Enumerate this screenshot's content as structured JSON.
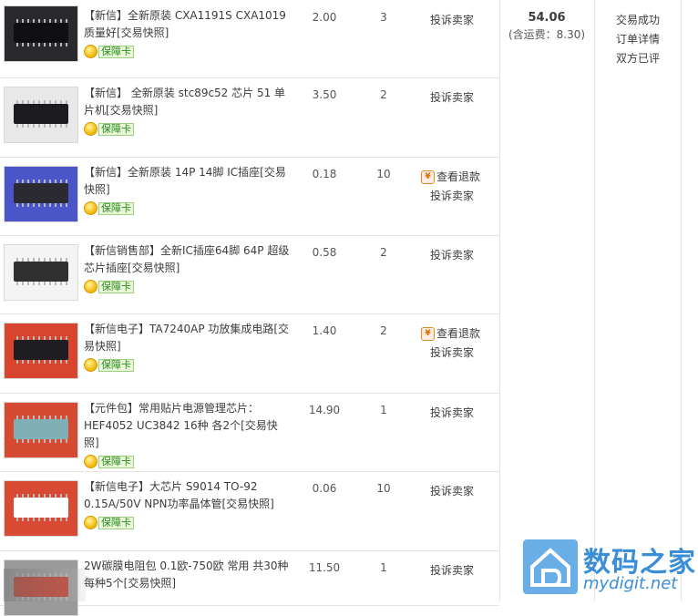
{
  "items": [
    {
      "title": "【新信】全新原装 CXA1191S CXA1019 质量好[交易快照]",
      "price": "2.00",
      "qty": "3",
      "actions": [
        "投诉卖家"
      ],
      "badge": "保障卡",
      "thumb_bg": "#2a2a2e",
      "thumb_fg": "#101012"
    },
    {
      "title": "【新信】 全新原装 stc89c52 芯片 51 单片机[交易快照]",
      "price": "3.50",
      "qty": "2",
      "actions": [
        "投诉卖家"
      ],
      "badge": "保障卡",
      "thumb_bg": "#e8e8e8",
      "thumb_fg": "#1c1c20"
    },
    {
      "title": "【新信】全新原装 14P 14脚 IC插座[交易快照]",
      "price": "0.18",
      "qty": "10",
      "actions": [
        "查看退款",
        "投诉卖家"
      ],
      "badge": "保障卡",
      "thumb_bg": "#4a56c8",
      "thumb_fg": "#2a2a30"
    },
    {
      "title": "【新信销售部】全新IC插座64脚 64P 超级芯片插座[交易快照]",
      "price": "0.58",
      "qty": "2",
      "actions": [
        "投诉卖家"
      ],
      "badge": "保障卡",
      "thumb_bg": "#f4f4f4",
      "thumb_fg": "#303030"
    },
    {
      "title": "【新信电子】TA7240AP 功放集成电路[交易快照]",
      "price": "1.40",
      "qty": "2",
      "actions": [
        "查看退款",
        "投诉卖家"
      ],
      "badge": "保障卡",
      "thumb_bg": "#d8452e",
      "thumb_fg": "#1e1e22"
    },
    {
      "title": "【元件包】常用贴片电源管理芯片：HEF4052 UC3842 16种 各2个[交易快照]",
      "price": "14.90",
      "qty": "1",
      "actions": [
        "投诉卖家"
      ],
      "badge": "保障卡",
      "thumb_bg": "#d64a32",
      "thumb_fg": "#7fb0b8"
    },
    {
      "title": "【新信电子】大芯片 S9014 TO-92 0.15A/50V NPN功率晶体管[交易快照]",
      "price": "0.06",
      "qty": "10",
      "actions": [
        "投诉卖家"
      ],
      "badge": "保障卡",
      "thumb_bg": "#d84a34",
      "thumb_fg": "#ffffff"
    },
    {
      "title": "2W碳膜电阻包 0.1欧-750欧 常用 共30种每种5个[交易快照]",
      "price": "11.50",
      "qty": "1",
      "actions": [
        "投诉卖家"
      ],
      "badge": "",
      "thumb_bg": "#9a9a9a",
      "thumb_fg": "#c23a2a"
    }
  ],
  "order": {
    "total": "54.06",
    "shipping": "(含运费：8.30)"
  },
  "status": [
    "交易成功",
    "订单详情",
    "双方已评"
  ],
  "watermark": {
    "brand": "数码之家",
    "url": "mydigit.net"
  },
  "colors": {
    "border": "#e4e4e4",
    "badge_green": "#2e8b22",
    "refund_orange": "#d86a00",
    "watermark_blue": "#3a8ed8"
  }
}
